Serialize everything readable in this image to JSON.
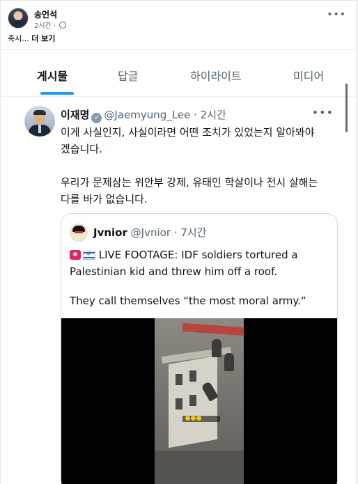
{
  "fb_post": {
    "author": "송언석",
    "time": "2시간",
    "caption_start": "축시...",
    "see_more": "더 보기"
  },
  "x_tabs": [
    {
      "label": "게시물",
      "active": true
    },
    {
      "label": "답글",
      "active": false
    },
    {
      "label": "하이라이트",
      "active": false
    },
    {
      "label": "미디어",
      "active": false
    }
  ],
  "tweet": {
    "name": "이재명",
    "handle": "@Jaemyung_Lee",
    "separator": "·",
    "time": "2시간",
    "paragraph1_line1": "이게 사실인지, 사실이라면 어떤 조치가 있었는지 알아봐야",
    "paragraph1_line2": "겠습니다.",
    "paragraph2_line1": "우리가 문제삼는 위안부 강제, 유태인 학살이나 전시 살해는",
    "paragraph2_line2": "다를 바가 없습니다."
  },
  "quoted_tweet": {
    "name": "Jvnior",
    "handle": "@Jvnior",
    "separator": "·",
    "time": "7시간",
    "line1": " LIVE FOOTAGE: IDF soldiers tortured a",
    "line2": "Palestinian kid and threw him off a roof.",
    "line3": "They call themselves “the most moral army.”"
  },
  "icons": {
    "fb_privacy": "globe-icon",
    "more": "more-horizontal-icon",
    "verified": "verified-badge-icon"
  },
  "colors": {
    "accent": "#1d9bf0",
    "secondary_text": "#536471",
    "fb_secondary": "#65676b",
    "verified_badge": "#829aab"
  }
}
